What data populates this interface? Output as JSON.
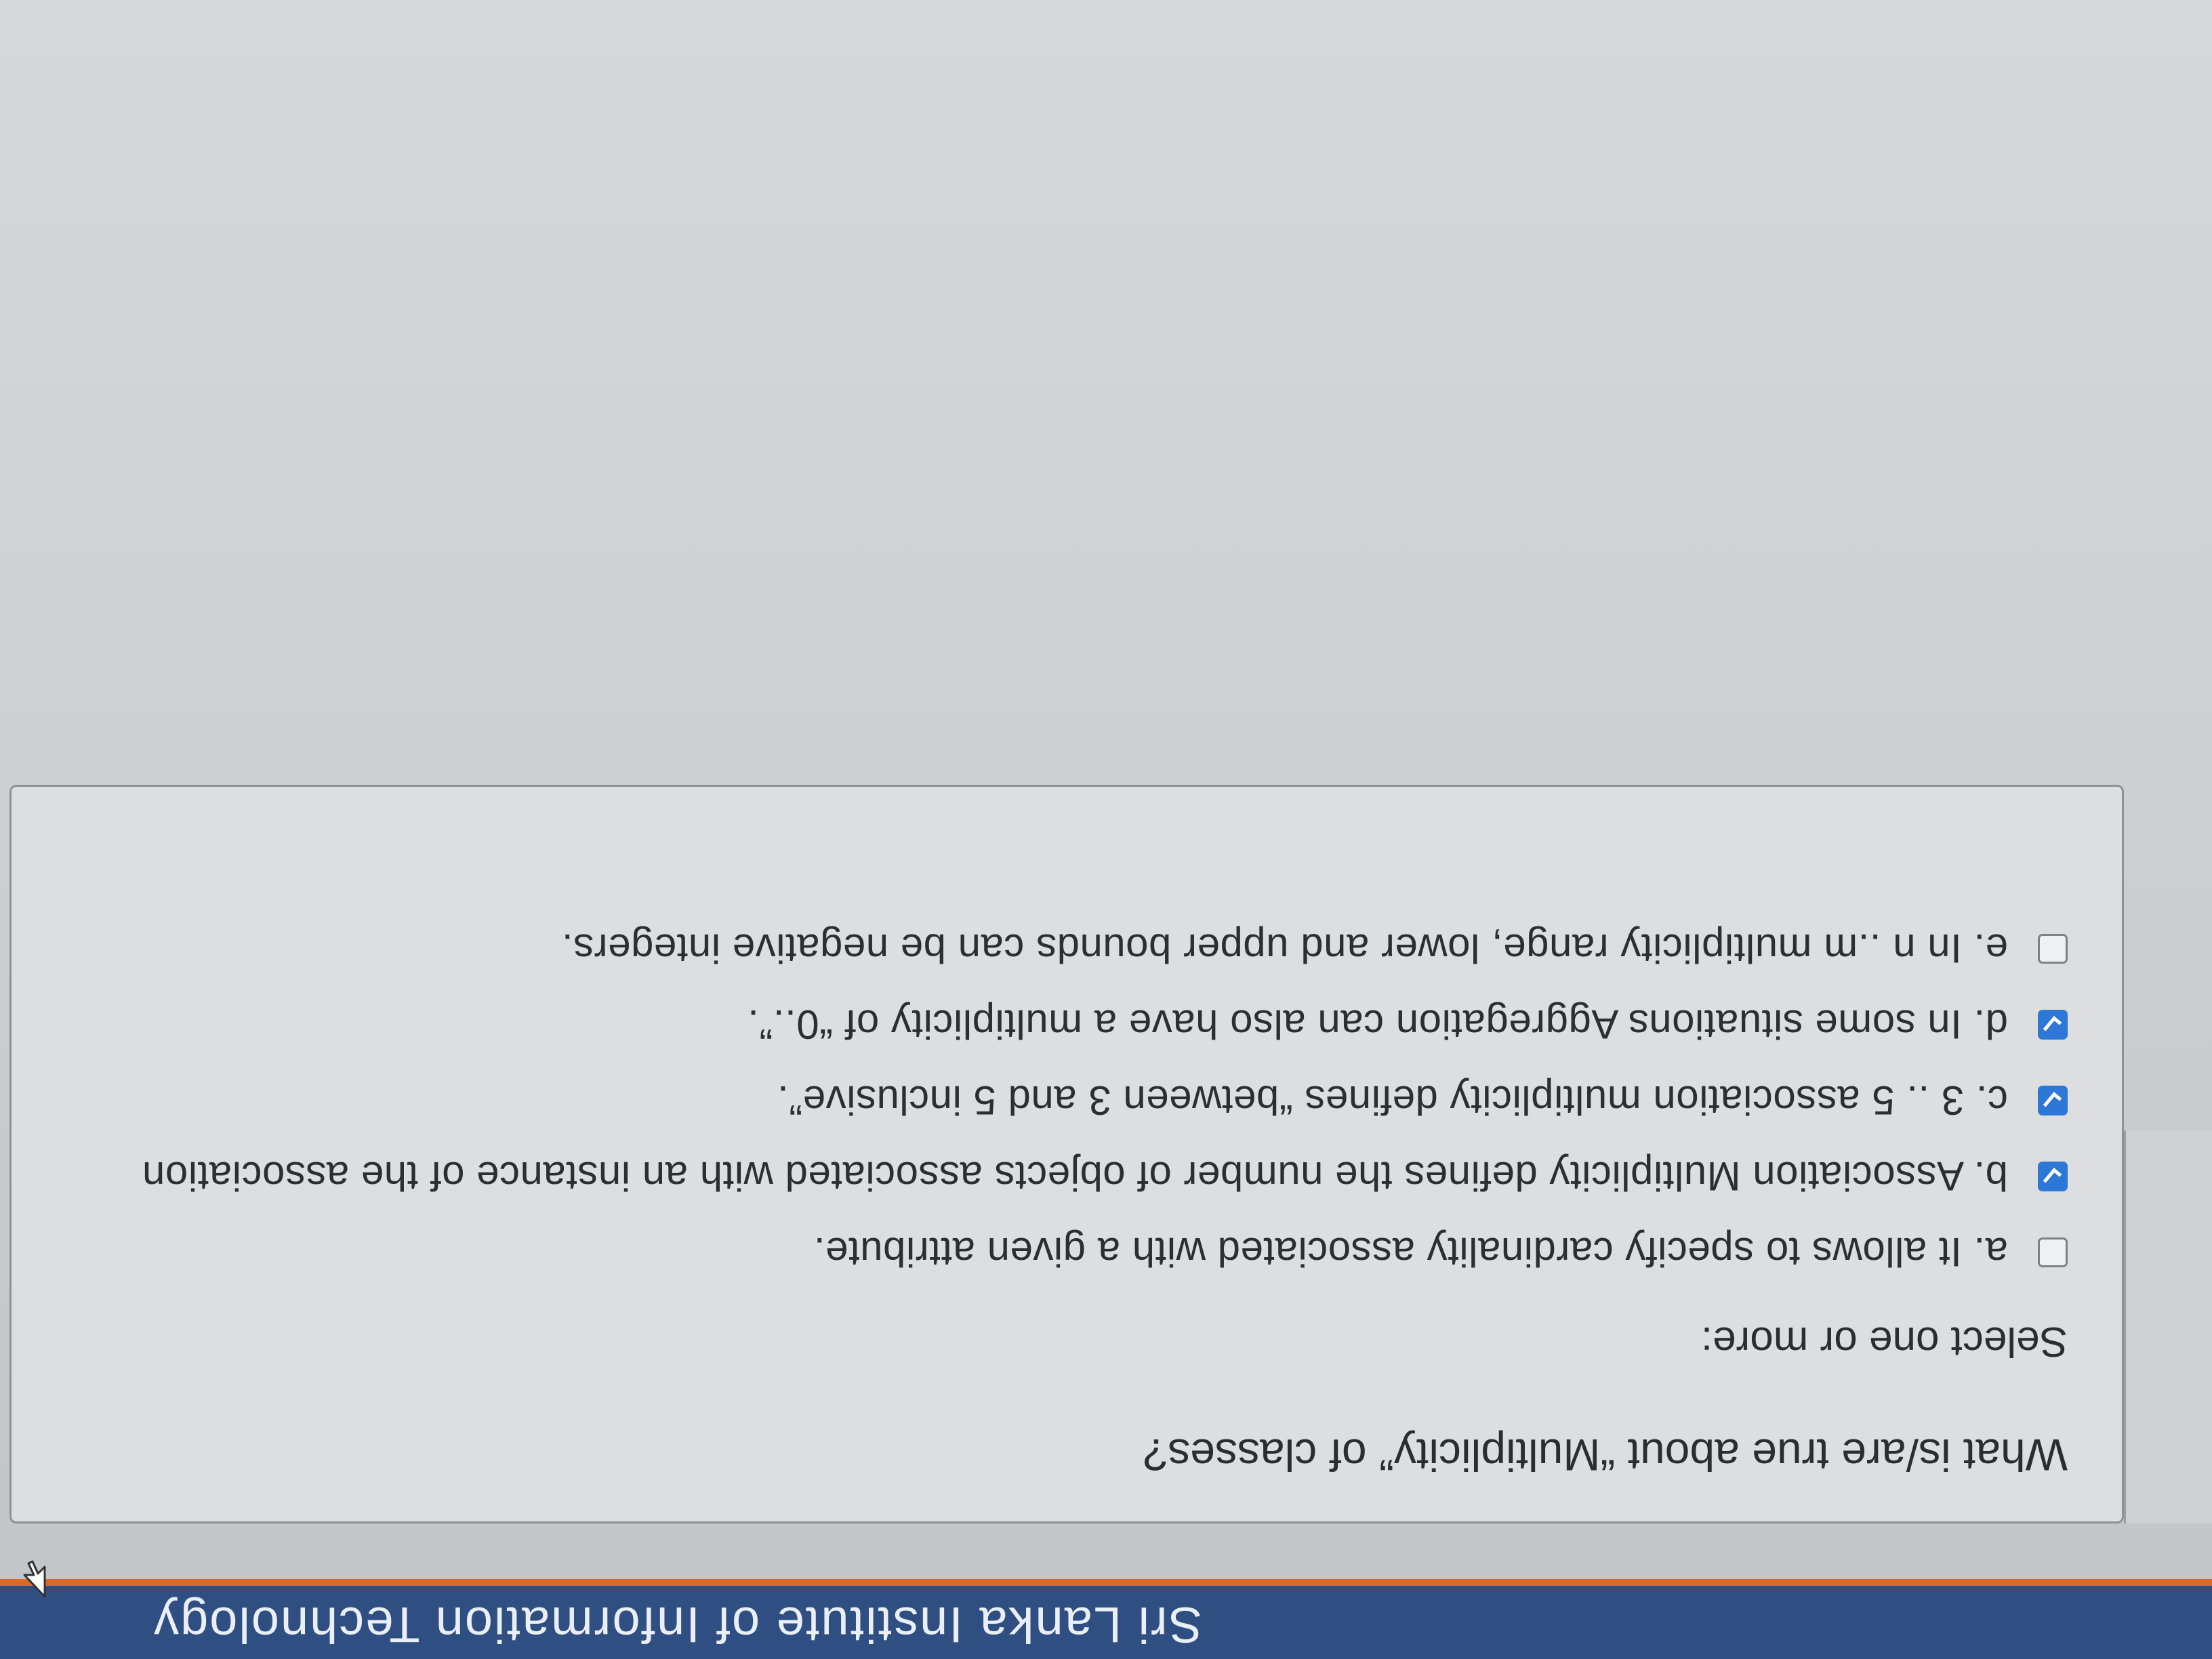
{
  "header": {
    "title": "Sri Lanka Institute of Information Technology"
  },
  "quiz": {
    "question": "What is/are true about “Multiplicity” of classes?",
    "prompt": "Select one or more:",
    "options": [
      {
        "label": "a. It allows to specify cardinality associated with a given attribute.",
        "checked": false
      },
      {
        "label": "b. Association Multiplicity defines the number of objects associated with an instance of the association",
        "checked": true
      },
      {
        "label": "c. 3 .. 5 association multiplicity defines “between 3 and 5 inclusive”.",
        "checked": true
      },
      {
        "label": "d. In some situations Aggregation can also have a multiplicity of “0..”.",
        "checked": true
      },
      {
        "label": "e. In n ..m  multiplicity range, lower and upper bounds can be negative integers.",
        "checked": false
      }
    ]
  },
  "icons": {
    "checkbox_checked": "checkbox-checked-icon",
    "checkbox_unchecked": "checkbox-unchecked-icon",
    "cursor": "mouse-pointer-icon"
  },
  "colors": {
    "header": "#2f4f82",
    "header_accent": "#d86a26",
    "checkbox_checked": "#2d78d6"
  }
}
